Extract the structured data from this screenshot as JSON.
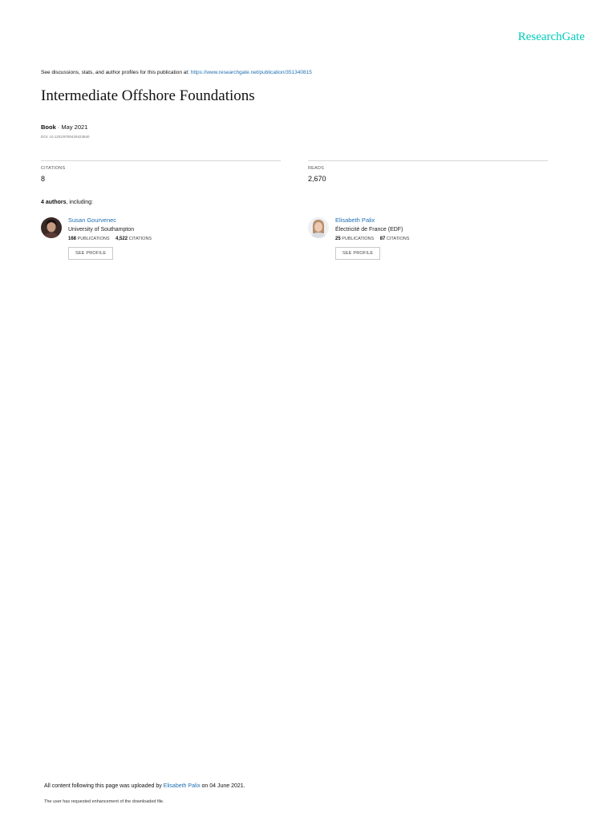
{
  "header": {
    "brand": "ResearchGate",
    "discuss_text": "See discussions, stats, and author profiles for this publication at: ",
    "discuss_link": "https://www.researchgate.net/publication/351340815"
  },
  "publication": {
    "title": "Intermediate Offshore Foundations",
    "type": "Book",
    "date_sep": " · ",
    "date": "May 2021",
    "doi": "DOI: 10.1201/9780429423840"
  },
  "stats": {
    "citations_label": "CITATIONS",
    "citations_value": "8",
    "reads_label": "READS",
    "reads_value": "2,670"
  },
  "authors_heading": {
    "count": "4 authors",
    "suffix": ", including:"
  },
  "authors": [
    {
      "name": "Susan Gourvenec",
      "institution": "University of Southampton",
      "publications": "168",
      "publications_label": "PUBLICATIONS",
      "citations": "4,522",
      "citations_label": "CITATIONS",
      "button": "SEE PROFILE"
    },
    {
      "name": "Elisabeth Palix",
      "institution": "Électricité de France (EDF)",
      "publications": "25",
      "publications_label": "PUBLICATIONS",
      "citations": "87",
      "citations_label": "CITATIONS",
      "button": "SEE PROFILE"
    }
  ],
  "footer": {
    "uploaded_prefix": "All content following this page was uploaded by ",
    "uploader": "Elisabeth Palix",
    "uploaded_suffix": " on 04 June 2021.",
    "note": "The user has requested enhancement of the downloaded file."
  },
  "colors": {
    "brand": "#00ccbb",
    "link": "#1f6fb2"
  }
}
